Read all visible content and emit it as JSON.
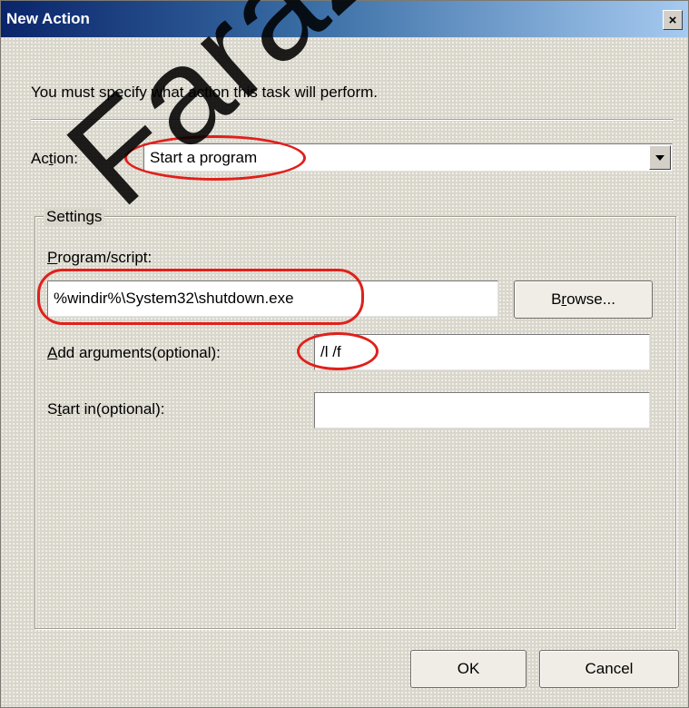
{
  "dialog": {
    "title": "New Action",
    "close_glyph": "×",
    "instruction": "You must specify what action this task will perform."
  },
  "action": {
    "label_pre": "Ac",
    "label_mnemonic": "t",
    "label_post": "ion:",
    "selected": "Start a program"
  },
  "settings": {
    "legend": "Settings",
    "program": {
      "label_mnemonic": "P",
      "label_post": "rogram/script:",
      "value": "%windir%\\System32\\shutdown.exe"
    },
    "browse": {
      "label_pre": "B",
      "label_mnemonic": "r",
      "label_post": "owse..."
    },
    "arguments": {
      "label_mnemonic": "A",
      "label_post": "dd arguments(optional):",
      "value": "/l /f"
    },
    "start_in": {
      "label_pre": "S",
      "label_mnemonic": "t",
      "label_post": "art in(optional):",
      "value": ""
    }
  },
  "buttons": {
    "ok": "OK",
    "cancel": "Cancel"
  },
  "watermark": "FarazNet",
  "colors": {
    "annotation": "#e0201b",
    "titlebar_start": "#0a246a",
    "titlebar_end": "#a6caf0"
  }
}
